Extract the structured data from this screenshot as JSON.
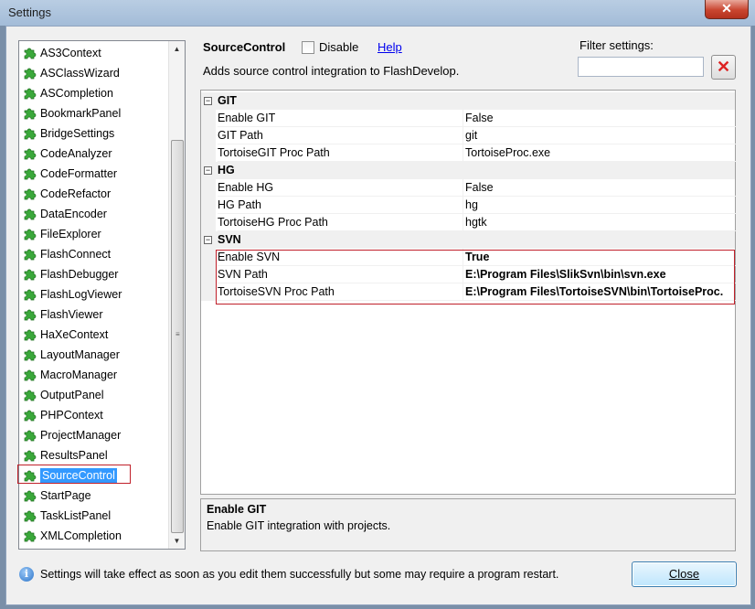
{
  "window": {
    "title": "Settings",
    "close_glyph": "✕"
  },
  "plugins": {
    "items": [
      {
        "label": "AS3Context"
      },
      {
        "label": "ASClassWizard"
      },
      {
        "label": "ASCompletion"
      },
      {
        "label": "BookmarkPanel"
      },
      {
        "label": "BridgeSettings"
      },
      {
        "label": "CodeAnalyzer"
      },
      {
        "label": "CodeFormatter"
      },
      {
        "label": "CodeRefactor"
      },
      {
        "label": "DataEncoder"
      },
      {
        "label": "FileExplorer"
      },
      {
        "label": "FlashConnect"
      },
      {
        "label": "FlashDebugger"
      },
      {
        "label": "FlashLogViewer"
      },
      {
        "label": "FlashViewer"
      },
      {
        "label": "HaXeContext"
      },
      {
        "label": "LayoutManager"
      },
      {
        "label": "MacroManager"
      },
      {
        "label": "OutputPanel"
      },
      {
        "label": "PHPContext"
      },
      {
        "label": "ProjectManager"
      },
      {
        "label": "ResultsPanel"
      },
      {
        "label": "SourceControl",
        "selected": true
      },
      {
        "label": "StartPage"
      },
      {
        "label": "TaskListPanel"
      },
      {
        "label": "XMLCompletion"
      }
    ],
    "icon": "puzzle-piece-icon",
    "icon_color": "#3aa83a",
    "selection_color": "#3399ff",
    "highlight_color": "#c0202a"
  },
  "header": {
    "title": "SourceControl",
    "disable_label": "Disable",
    "disable_checked": false,
    "help_label": "Help",
    "description": "Adds source control integration to FlashDevelop.",
    "filter_label": "Filter settings:",
    "filter_value": "",
    "clear_icon": "red-x-icon"
  },
  "grid": {
    "categories": [
      {
        "name": "GIT",
        "toggle": "⊟",
        "props": [
          {
            "name": "Enable GIT",
            "value": "False"
          },
          {
            "name": "GIT Path",
            "value": "git"
          },
          {
            "name": "TortoiseGIT Proc Path",
            "value": "TortoiseProc.exe"
          }
        ]
      },
      {
        "name": "HG",
        "toggle": "⊟",
        "props": [
          {
            "name": "Enable HG",
            "value": "False"
          },
          {
            "name": "HG Path",
            "value": "hg"
          },
          {
            "name": "TortoiseHG Proc Path",
            "value": "hgtk"
          }
        ]
      },
      {
        "name": "SVN",
        "toggle": "⊟",
        "props": [
          {
            "name": "Enable SVN",
            "value": "True",
            "bold": true
          },
          {
            "name": "SVN Path",
            "value": "E:\\Program Files\\SlikSvn\\bin\\svn.exe",
            "bold": true
          },
          {
            "name": "TortoiseSVN Proc Path",
            "value": "E:\\Program Files\\TortoiseSVN\\bin\\TortoiseProc.",
            "bold": true
          }
        ]
      }
    ]
  },
  "info": {
    "title": "Enable GIT",
    "text": "Enable GIT integration with projects."
  },
  "footer": {
    "message": "Settings will take effect as soon as you edit them successfully but some may require a program restart.",
    "close_label": "Close",
    "info_icon": "info-icon"
  }
}
